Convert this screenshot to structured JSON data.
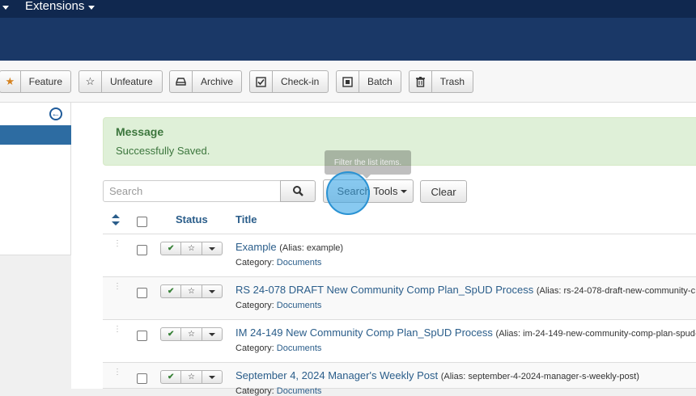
{
  "topnav": {
    "extensions_label": "Extensions"
  },
  "toolbar": {
    "feature": "Feature",
    "unfeature": "Unfeature",
    "archive": "Archive",
    "checkin": "Check-in",
    "batch": "Batch",
    "trash": "Trash"
  },
  "message": {
    "heading": "Message",
    "text": "Successfully Saved."
  },
  "filter": {
    "search_placeholder": "Search",
    "search_tools_label": "Search Tools",
    "clear_label": "Clear",
    "tooltip": "Filter the list items."
  },
  "table": {
    "columns": {
      "status": "Status",
      "title": "Title"
    },
    "rows": [
      {
        "title": "Example",
        "alias": "(Alias: example)",
        "category_label": "Category:",
        "category": "Documents"
      },
      {
        "title": "RS 24-078 DRAFT New Community Comp Plan_SpUD Process",
        "alias": "(Alias: rs-24-078-draft-new-community-c",
        "category_label": "Category:",
        "category": "Documents"
      },
      {
        "title": "IM 24-149 New Community Comp Plan_SpUD Process",
        "alias": "(Alias: im-24-149-new-community-comp-plan-spud-",
        "category_label": "Category:",
        "category": "Documents"
      },
      {
        "title": "September 4, 2024 Manager's Weekly Post",
        "alias": "(Alias: september-4-2024-manager-s-weekly-post)",
        "category_label": "Category:",
        "category": "Documents"
      }
    ]
  },
  "colors": {
    "nav_bg": "#10284f",
    "header_bg": "#1a3867",
    "link": "#2a5d8a",
    "success_bg": "#dff0d8",
    "success_text": "#3c763d"
  }
}
